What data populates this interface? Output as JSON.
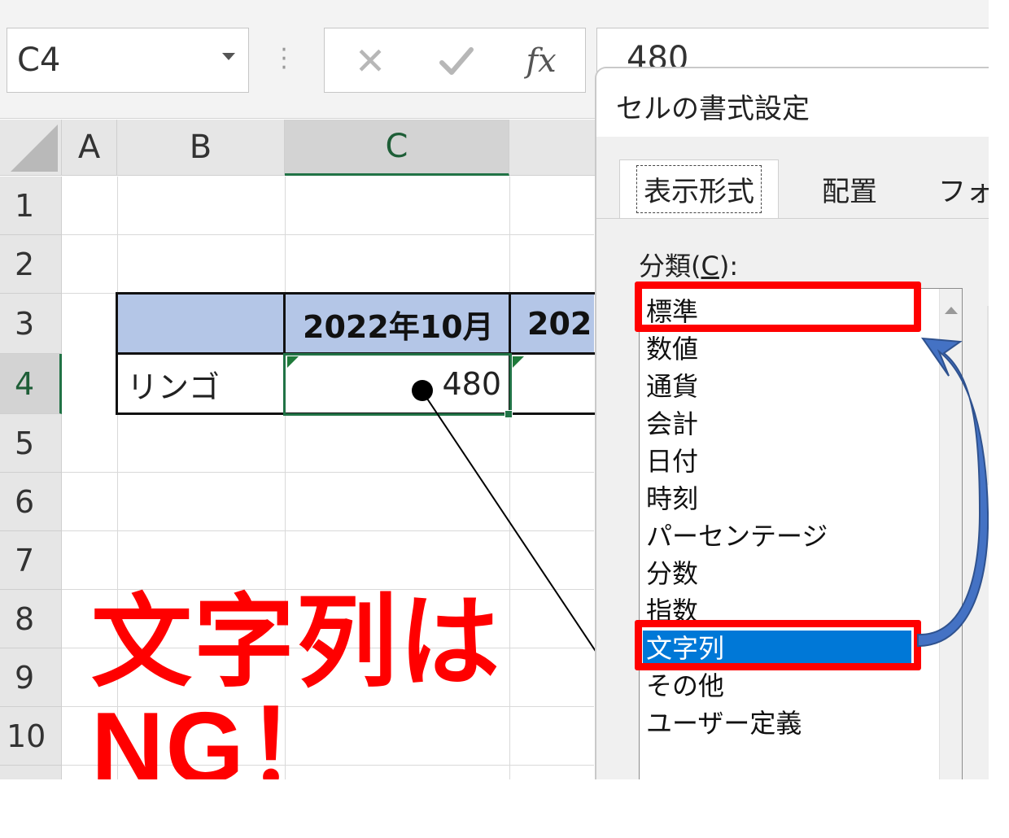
{
  "name_box": {
    "value": "C4"
  },
  "formula_bar": {
    "cancel_glyph": "✕",
    "fx_label": "fx",
    "value": "480"
  },
  "columns": [
    "A",
    "B",
    "C"
  ],
  "rows": [
    "1",
    "2",
    "3",
    "4",
    "5",
    "6",
    "7",
    "8",
    "9",
    "10"
  ],
  "sheet": {
    "header_c3": "2022年10月",
    "header_d3_partial": "202",
    "b4": "リンゴ",
    "c4": "480"
  },
  "callout": {
    "text_line1": "文字列は",
    "text_line2": "NG！",
    "color": "#ff0000"
  },
  "dialog": {
    "title": "セルの書式設定",
    "tabs": [
      "表示形式",
      "配置",
      "フォ"
    ],
    "active_tab": "表示形式",
    "category_label_prefix": "分類(",
    "category_label_accel": "C",
    "category_label_suffix": "):",
    "categories": [
      "標準",
      "数値",
      "通貨",
      "会計",
      "日付",
      "時刻",
      "パーセンテージ",
      "分数",
      "指数",
      "文字列",
      "その他",
      "ユーザー定義"
    ],
    "selected_category": "文字列",
    "selection_color": "#0078d7"
  },
  "colors": {
    "excel_green": "#217346",
    "header_fill": "#b4c6e7",
    "arrow_blue": "#4472c4",
    "highlight_red": "#ff0000"
  }
}
